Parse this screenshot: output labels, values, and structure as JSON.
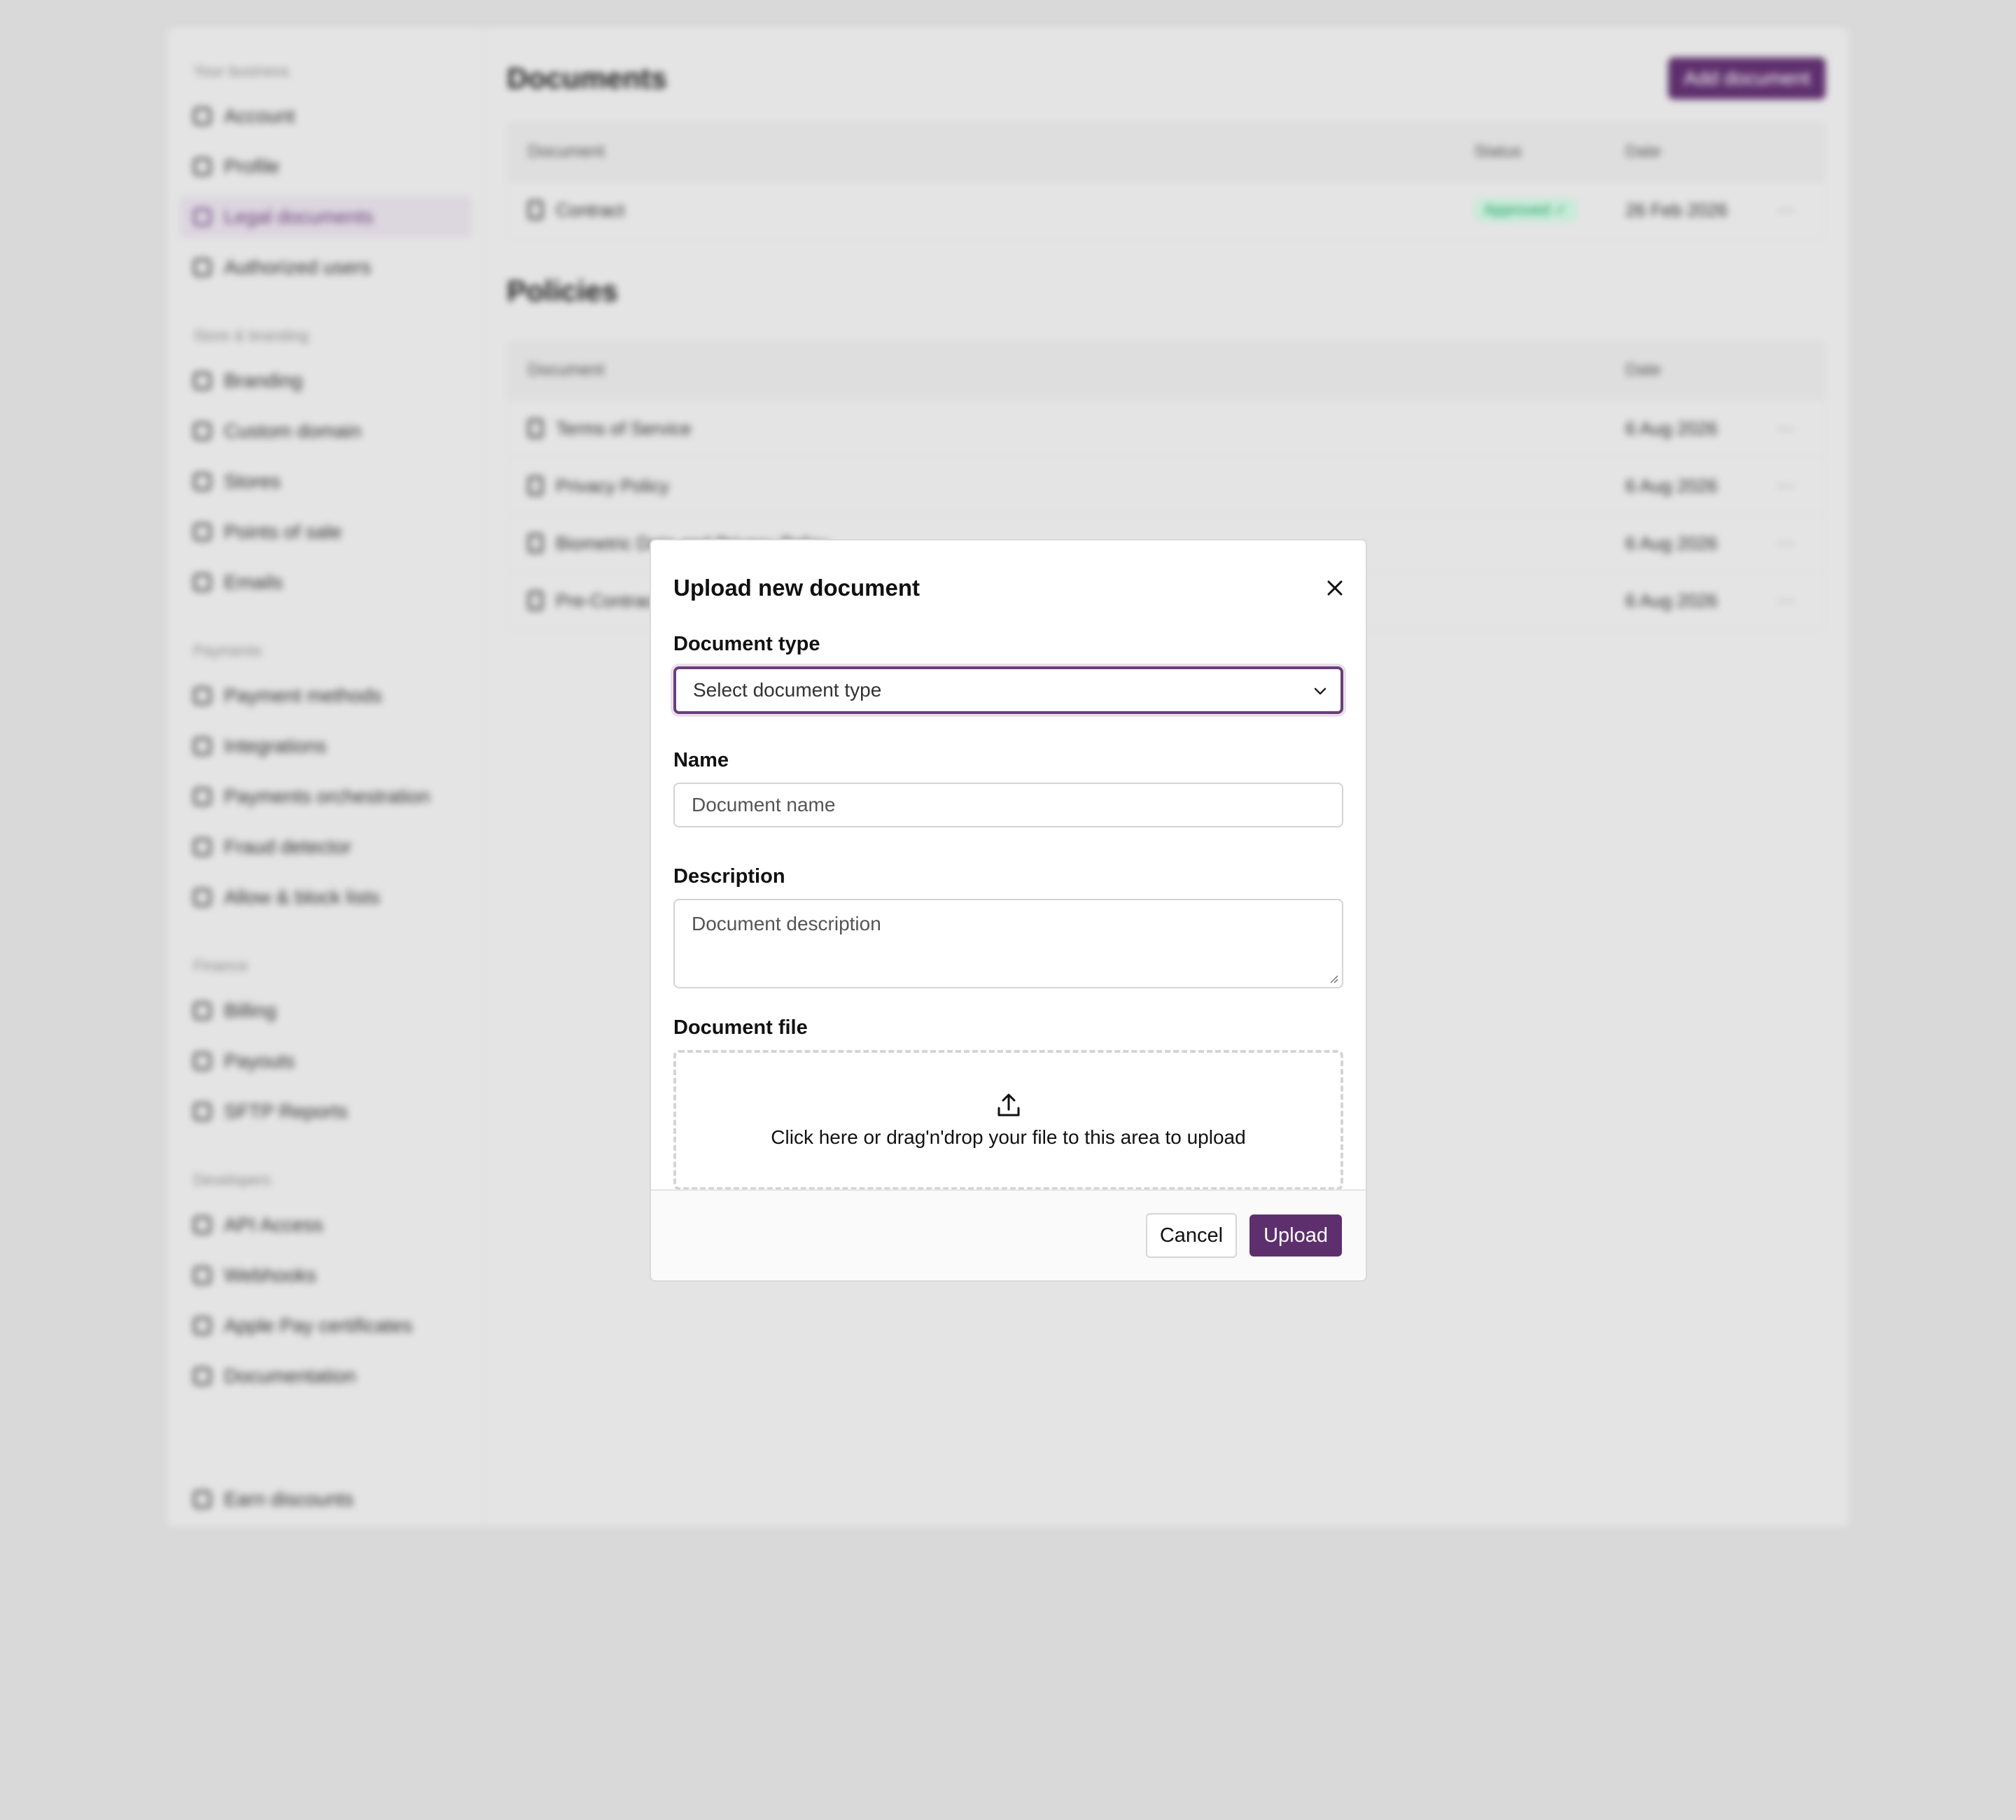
{
  "sidebar": {
    "sections": [
      {
        "heading": "Your business",
        "items": [
          {
            "label": "Account",
            "icon": "home-icon"
          },
          {
            "label": "Profile",
            "icon": "user-icon"
          },
          {
            "label": "Legal documents",
            "icon": "document-icon",
            "active": true
          },
          {
            "label": "Authorized users",
            "icon": "users-icon"
          }
        ]
      },
      {
        "heading": "Store & branding",
        "items": [
          {
            "label": "Branding",
            "icon": "brush-icon"
          },
          {
            "label": "Custom domain",
            "icon": "globe-icon"
          },
          {
            "label": "Stores",
            "icon": "store-icon"
          },
          {
            "label": "Points of sale",
            "icon": "pos-icon"
          },
          {
            "label": "Emails",
            "icon": "mail-icon"
          }
        ]
      },
      {
        "heading": "Payments",
        "items": [
          {
            "label": "Payment methods",
            "icon": "card-icon"
          },
          {
            "label": "Integrations",
            "icon": "grid-icon"
          },
          {
            "label": "Payments orchestration",
            "icon": "route-icon"
          },
          {
            "label": "Fraud detector",
            "icon": "shield-icon"
          },
          {
            "label": "Allow & block lists",
            "icon": "list-icon"
          }
        ]
      },
      {
        "heading": "Finance",
        "items": [
          {
            "label": "Billing",
            "icon": "billing-icon"
          },
          {
            "label": "Payouts",
            "icon": "payout-icon"
          },
          {
            "label": "SFTP Reports",
            "icon": "sync-icon"
          }
        ]
      },
      {
        "heading": "Developers",
        "items": [
          {
            "label": "API Access",
            "icon": "key-icon"
          },
          {
            "label": "Webhooks",
            "icon": "webhook-icon"
          },
          {
            "label": "Apple Pay certificates",
            "icon": "certificate-icon"
          },
          {
            "label": "Documentation",
            "icon": "code-icon"
          }
        ]
      }
    ],
    "bottom_item": {
      "label": "Earn discounts",
      "icon": "gift-icon"
    }
  },
  "main": {
    "title": "Documents",
    "add_button": "Add document",
    "documents_table": {
      "headers": [
        "Document",
        "Status",
        "Date"
      ],
      "rows": [
        {
          "name": "Contract",
          "status": "Approved ✓",
          "date": "26 Feb 2026",
          "menu": "⋯"
        }
      ]
    },
    "policies_title": "Policies",
    "policies_table": {
      "headers": [
        "Document",
        "Date"
      ],
      "rows": [
        {
          "name": "Terms of Service",
          "date": "6 Aug 2026",
          "menu": "⋯"
        },
        {
          "name": "Privacy Policy",
          "date": "6 Aug 2026",
          "menu": "⋯"
        },
        {
          "name": "Biometric Data and Privacy Policy",
          "date": "6 Aug 2026",
          "menu": "⋯"
        },
        {
          "name": "Pre-Contractual Information",
          "date": "6 Aug 2026",
          "menu": "⋯"
        }
      ]
    }
  },
  "modal": {
    "title": "Upload new document",
    "document_type": {
      "label": "Document type",
      "value": "Select document type"
    },
    "name": {
      "label": "Name",
      "placeholder": "Document name"
    },
    "description": {
      "label": "Description",
      "placeholder": "Document description"
    },
    "file": {
      "label": "Document file",
      "dropzone_text": "Click here or drag'n'drop your file to this area to upload"
    },
    "cancel_label": "Cancel",
    "upload_label": "Upload"
  },
  "colors": {
    "accent": "#5e2f6d",
    "approved": "#1f9f63"
  }
}
